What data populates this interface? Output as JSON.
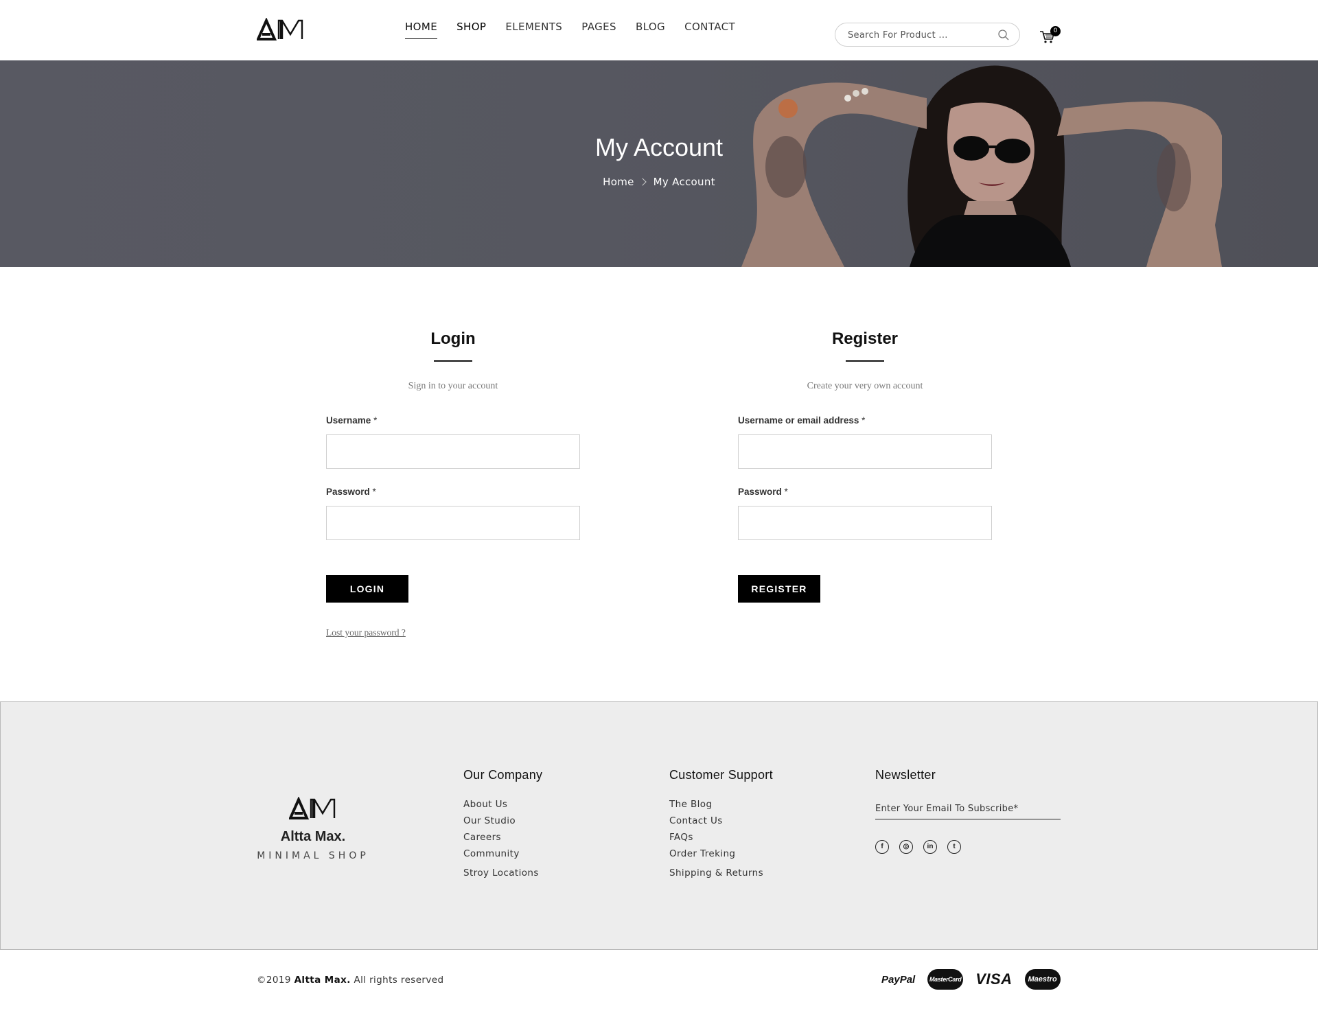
{
  "header": {
    "nav": [
      "HOME",
      "SHOP",
      "ELEMENTS",
      "PAGES",
      "BLOG",
      "CONTACT"
    ],
    "search_placeholder": "Search For Product ...",
    "cart_count": "0"
  },
  "hero": {
    "title": "My Account",
    "breadcrumb": [
      "Home",
      "My Account"
    ]
  },
  "login": {
    "title": "Login",
    "subtitle": "Sign in to your account",
    "username_label": "Username",
    "password_label": "Password",
    "required_mark": "*",
    "button": "LOGIN",
    "lost_password": "Lost your password ?"
  },
  "register": {
    "title": "Register",
    "subtitle": "Create your very own account",
    "username_label": "Username or email address",
    "password_label": "Password",
    "required_mark": "*",
    "button": "REGISTER"
  },
  "footer": {
    "brand": "Altta Max.",
    "tagline": "MINIMAL SHOP",
    "company": {
      "title": "Our Company",
      "links": [
        "About Us",
        "Our Studio",
        "Careers",
        "Community",
        "Stroy Locations"
      ]
    },
    "support": {
      "title": "Customer Support",
      "links": [
        "The Blog",
        "Contact Us",
        "FAQs",
        "Order Treking",
        "Shipping & Returns"
      ]
    },
    "newsletter": {
      "title": "Newsletter",
      "placeholder": "Enter Your Email To Subscribe*"
    },
    "socials": [
      "facebook-icon",
      "instagram-icon",
      "linkedin-icon",
      "twitter-icon"
    ],
    "copyright_prefix": "©2019",
    "copyright_brand": "Altta Max.",
    "copyright_suffix": "All rights reserved",
    "payments": [
      "PayPal",
      "MasterCard",
      "VISA",
      "Maestro"
    ]
  }
}
